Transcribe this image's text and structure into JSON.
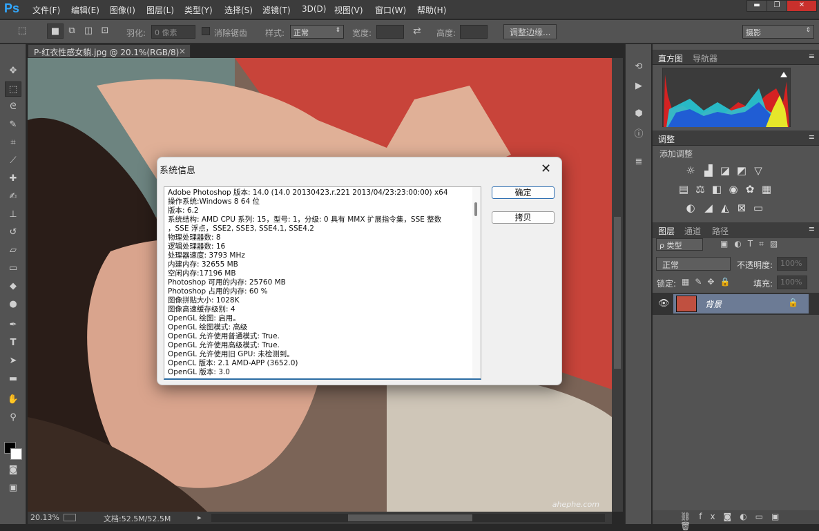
{
  "app": {
    "logo": "Ps"
  },
  "menu": [
    "文件(F)",
    "编辑(E)",
    "图像(I)",
    "图层(L)",
    "类型(Y)",
    "选择(S)",
    "滤镜(T)",
    "3D(D)",
    "视图(V)",
    "窗口(W)",
    "帮助(H)"
  ],
  "window_controls": {
    "minimize": "▬",
    "restore": "❐",
    "close": "✕"
  },
  "options": {
    "feather_label": "羽化:",
    "feather_value": "0 像素",
    "antialias_label": "消除锯齿",
    "style_label": "样式:",
    "style_value": "正常",
    "width_label": "宽度:",
    "height_label": "高度:",
    "refine_edge": "调整边缘...",
    "workspace": "摄影"
  },
  "document": {
    "tab_title": "P-红衣性感女躺.jpg @ 20.1%(RGB/8)",
    "tab_close": "×",
    "zoom": "20.13%",
    "doc_size": "文档:52.5M/52.5M"
  },
  "panels": {
    "histogram_tabs": [
      "直方图",
      "导航器"
    ],
    "adjust_tab": "调整",
    "adjust_add": "添加调整",
    "layers_tabs": [
      "图层",
      "通道",
      "路径"
    ],
    "kind_filter": "ρ 类型",
    "blend_mode": "正常",
    "opacity_label": "不透明度:",
    "opacity_value": "100%",
    "lock_label": "锁定:",
    "fill_label": "填充:",
    "fill_value": "100%",
    "layer_name": "背景"
  },
  "dialog": {
    "title": "系统信息",
    "close": "✕",
    "ok": "确定",
    "copy": "拷贝",
    "lines": [
      "Adobe Photoshop 版本: 14.0 (14.0 20130423.r.221 2013/04/23:23:00:00) x64",
      "操作系统:Windows 8 64 位",
      "版本: 6.2",
      "系统结构: AMD CPU 系列: 15，型号: 1，分级: 0 具有 MMX 扩展指令集，SSE 整数",
      "，SSE 浮点，SSE2, SSE3, SSE4.1, SSE4.2",
      "物理处理器数: 8",
      "逻辑处理器数: 16",
      "处理器速度: 3793 MHz",
      "内建内存: 32655 MB",
      "空闲内存:17196 MB",
      "Photoshop 可用的内存: 25760 MB",
      "Photoshop 占用的内存: 60 %",
      "图像拼贴大小: 1028K",
      "图像高速缓存级别: 4",
      "OpenGL 绘图: 启用。",
      "OpenGL 绘图模式: 高级",
      "OpenGL 允许使用普通模式: True.",
      "OpenGL 允许使用高级模式: True.",
      "OpenGL 允许使用旧 GPU: 未检测到。",
      "OpenCL 版本: 2.1 AMD-APP (3652.0)",
      "OpenGL 版本: 3.0"
    ]
  },
  "watermark": "ahephe.com"
}
